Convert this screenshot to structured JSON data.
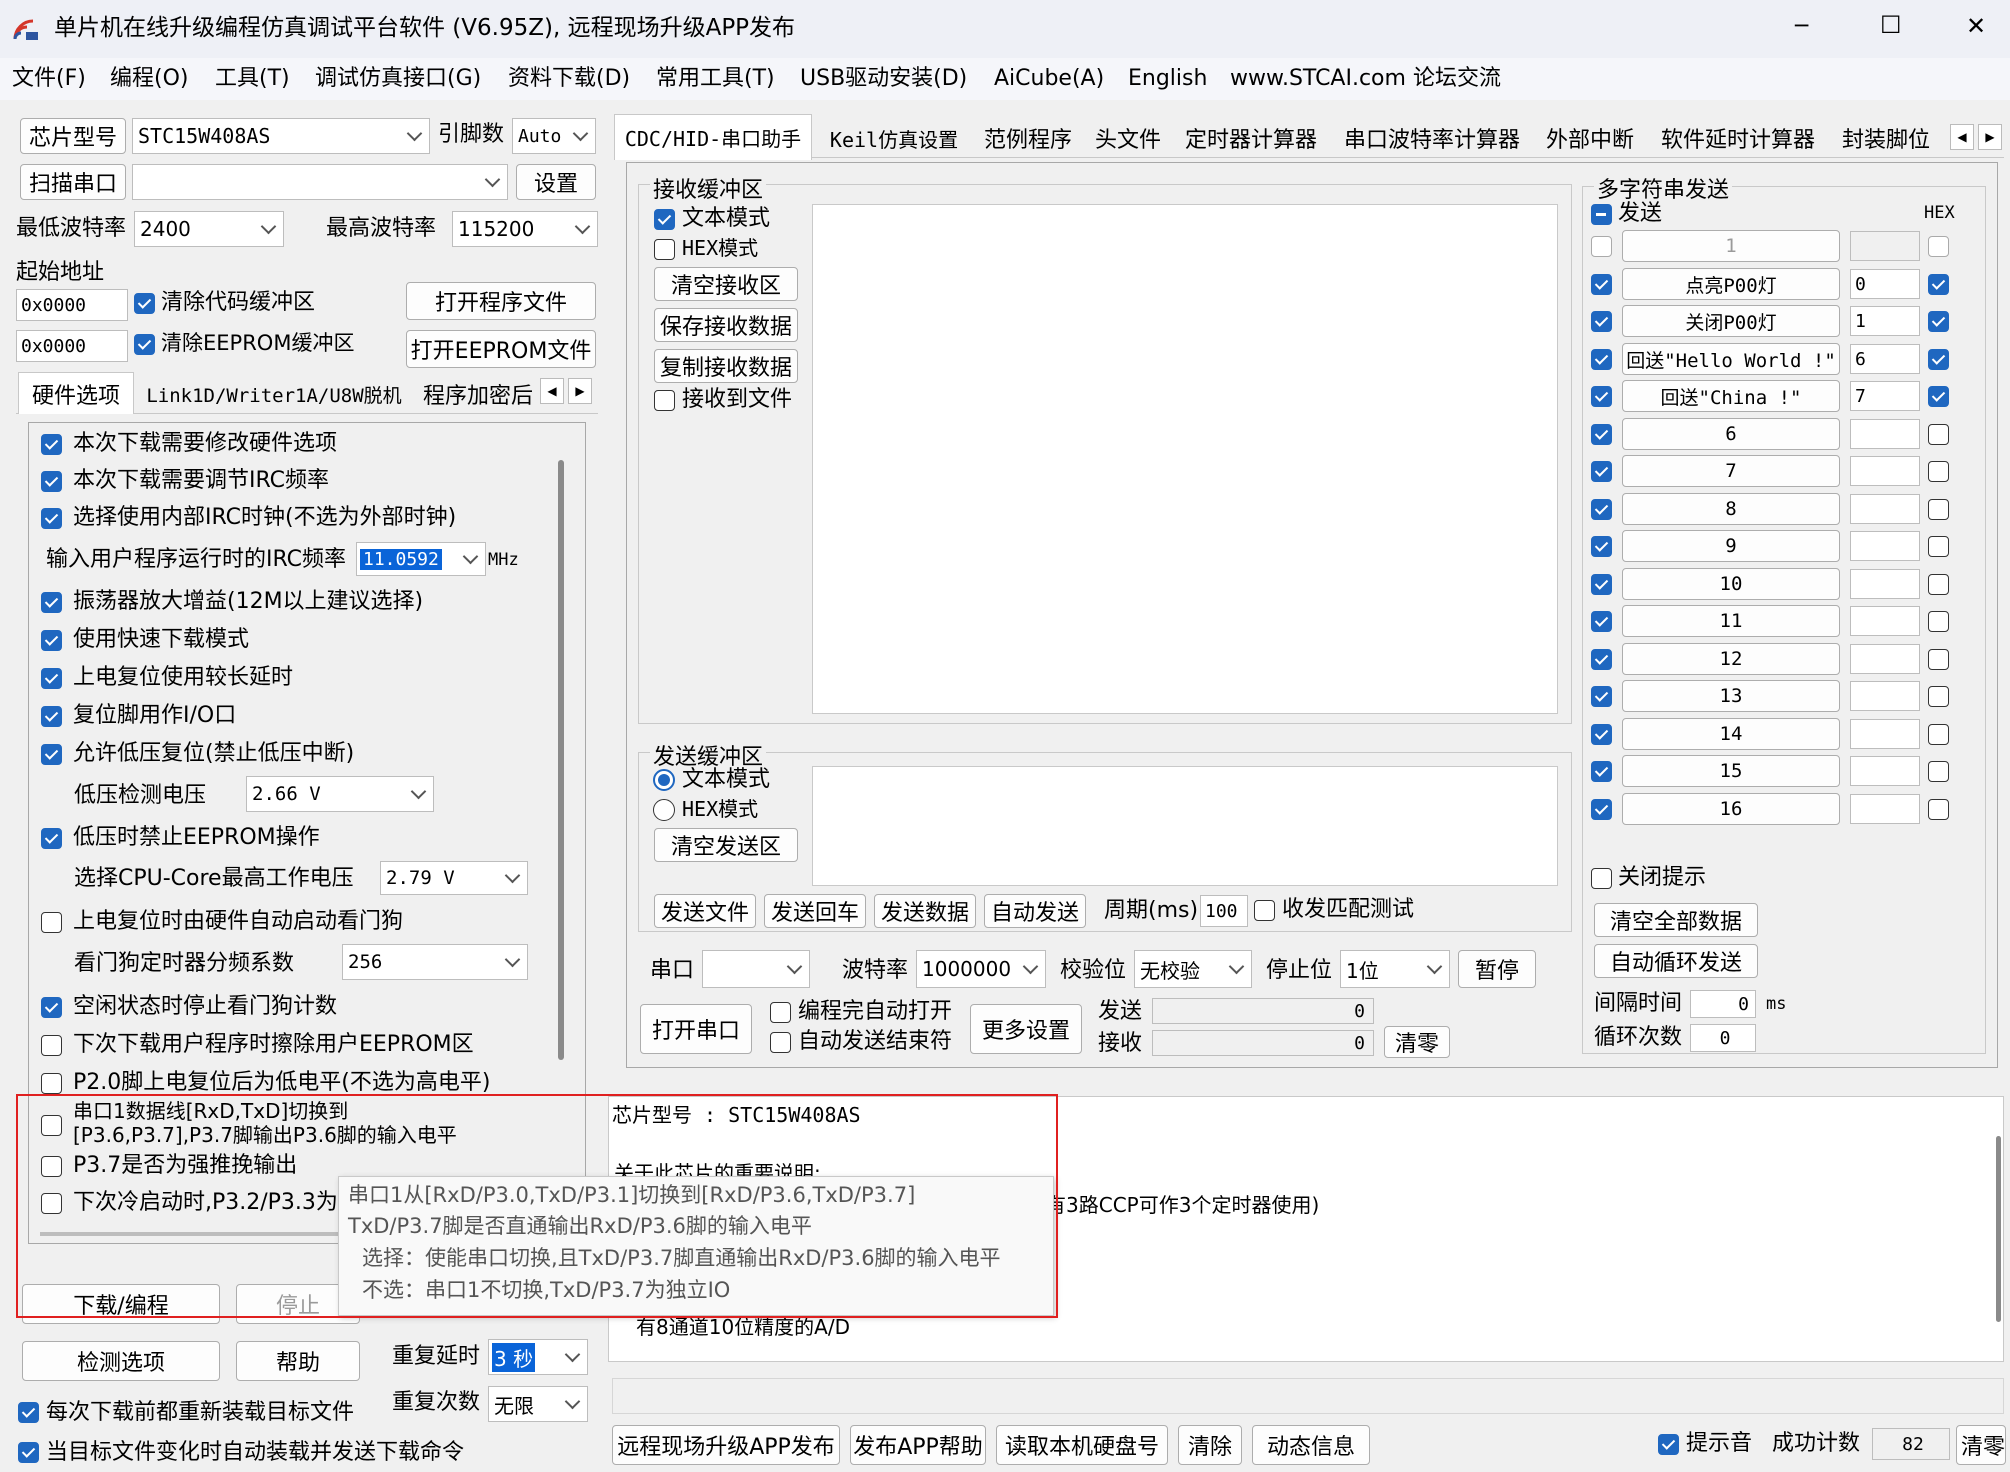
{
  "window": {
    "title": "单片机在线升级编程仿真调试平台软件 (V6.95Z), 远程现场升级APP发布",
    "controls": {
      "minimize": "─",
      "maximize": "☐",
      "close": "✕"
    }
  },
  "menu": [
    "文件(F)",
    "编程(O)",
    "工具(T)",
    "调试仿真接口(G)",
    "资料下载(D)",
    "常用工具(T)",
    "USB驱动安装(D)",
    "AiCube(A)",
    "English",
    "www.STCAI.com 论坛交流"
  ],
  "left": {
    "chip_label": "芯片型号",
    "chip_value": "STC15W408AS",
    "pins_label": "引脚数",
    "pins_value": "Auto",
    "scan_port": "扫描串口",
    "settings": "设置",
    "min_baud_label": "最低波特率",
    "min_baud_value": "2400",
    "max_baud_label": "最高波特率",
    "max_baud_value": "115200",
    "start_addr_label": "起始地址",
    "addr1": "0x0000",
    "clear_code": "清除代码缓冲区",
    "open_program": "打开程序文件",
    "addr2": "0x0000",
    "clear_eeprom": "清除EEPROM缓冲区",
    "open_eeprom": "打开EEPROM文件",
    "tabs": [
      "硬件选项",
      "Link1D/Writer1A/U8W脱机",
      "程序加密后"
    ],
    "options": {
      "o1": "本次下载需要修改硬件选项",
      "o2": "本次下载需要调节IRC频率",
      "o3": "选择使用内部IRC时钟(不选为外部时钟)",
      "irc_label": "输入用户程序运行时的IRC频率",
      "irc_value": "11.0592",
      "irc_unit": "MHz",
      "o4": "振荡器放大增益(12M以上建议选择)",
      "o5": "使用快速下载模式",
      "o6": "上电复位使用较长延时",
      "o7": "复位脚用作I/O口",
      "o8": "允许低压复位(禁止低压中断)",
      "lv_label": "低压检测电压",
      "lv_value": "2.66 V",
      "o9": "低压时禁止EEPROM操作",
      "cpu_label": "选择CPU-Core最高工作电压",
      "cpu_value": "2.79 V",
      "o10": "上电复位时由硬件自动启动看门狗",
      "wdt_label": "看门狗定时器分频系数",
      "wdt_value": "256",
      "o11": "空闲状态时停止看门狗计数",
      "o12": "下次下载用户程序时擦除用户EEPROM区",
      "o13": "P2.0脚上电复位后为低电平(不选为高电平)",
      "o14a": "串口1数据线[RxD,TxD]切换到",
      "o14b": "[P3.6,P3.7],P3.7脚输出P3.6脚的输入电平",
      "o15": "P3.7是否为强推挽输出",
      "o16": "下次冷启动时,P3.2/P3.3为"
    },
    "download": "下载/编程",
    "stop": "停止",
    "check_options": "检测选项",
    "help": "帮助",
    "repeat_delay_label": "重复延时",
    "repeat_delay_value": "3 秒",
    "repeat_count_label": "重复次数",
    "repeat_count_value": "无限",
    "reload_before": "每次下载前都重新装载目标文件",
    "auto_reload": "当目标文件变化时自动装载并发送下载命令"
  },
  "right_tabs": [
    "CDC/HID-串口助手",
    "Keil仿真设置",
    "范例程序",
    "头文件",
    "定时器计算器",
    "串口波特率计算器",
    "外部中断",
    "软件延时计算器",
    "封装脚位"
  ],
  "serial": {
    "recv_title": "接收缓冲区",
    "text_mode": "文本模式",
    "hex_mode": "HEX模式",
    "clear_recv": "清空接收区",
    "save_recv": "保存接收数据",
    "copy_recv": "复制接收数据",
    "recv_to_file": "接收到文件",
    "send_title": "发送缓冲区",
    "clear_send": "清空发送区",
    "send_file": "发送文件",
    "send_enter": "发送回车",
    "send_data": "发送数据",
    "auto_send": "自动发送",
    "period_label": "周期(ms)",
    "period_value": "100",
    "match_test": "收发匹配测试",
    "port_label": "串口",
    "baud_label": "波特率",
    "baud_value": "1000000",
    "parity_label": "校验位",
    "parity_value": "无校验",
    "stop_label": "停止位",
    "stop_value": "1位",
    "pause": "暂停",
    "open_port": "打开串口",
    "auto_open": "编程完自动打开",
    "auto_end": "自动发送结束符",
    "more_settings": "更多设置",
    "send_count_label": "发送",
    "send_count": "0",
    "recv_count_label": "接收",
    "recv_count": "0",
    "clear_count": "清零"
  },
  "multi": {
    "title": "多字符串发送",
    "send_header": "发送",
    "hex_header": "HEX",
    "rows": [
      {
        "label": "1",
        "value": "",
        "checked": false,
        "hex": false,
        "disabled": true
      },
      {
        "label": "点亮P00灯",
        "value": "0",
        "checked": true,
        "hex": true
      },
      {
        "label": "关闭P00灯",
        "value": "1",
        "checked": true,
        "hex": true
      },
      {
        "label": "回送\"Hello World !\"",
        "value": "6",
        "checked": true,
        "hex": true
      },
      {
        "label": "回送\"China !\"",
        "value": "7",
        "checked": true,
        "hex": true
      },
      {
        "label": "6",
        "value": "",
        "checked": true,
        "hex": false
      },
      {
        "label": "7",
        "value": "",
        "checked": true,
        "hex": false
      },
      {
        "label": "8",
        "value": "",
        "checked": true,
        "hex": false
      },
      {
        "label": "9",
        "value": "",
        "checked": true,
        "hex": false
      },
      {
        "label": "10",
        "value": "",
        "checked": true,
        "hex": false
      },
      {
        "label": "11",
        "value": "",
        "checked": true,
        "hex": false
      },
      {
        "label": "12",
        "value": "",
        "checked": true,
        "hex": false
      },
      {
        "label": "13",
        "value": "",
        "checked": true,
        "hex": false
      },
      {
        "label": "14",
        "value": "",
        "checked": true,
        "hex": false
      },
      {
        "label": "15",
        "value": "",
        "checked": true,
        "hex": false
      },
      {
        "label": "16",
        "value": "",
        "checked": true,
        "hex": false
      }
    ],
    "close_tips": "关闭提示",
    "clear_all": "清空全部数据",
    "auto_loop": "自动循环发送",
    "interval_label": "间隔时间",
    "interval_value": "0",
    "interval_unit": "ms",
    "loop_label": "循环次数",
    "loop_value": "0"
  },
  "info": {
    "line1": "芯片型号 : STC15W408AS",
    "line2": "关于此芯片的重要说明:",
    "line3": "有3路CCP可作3个定时器使用)",
    "line4": "有8通道10位精度的A/D"
  },
  "tooltip": {
    "l1": "串口1从[RxD/P3.0,TxD/P3.1]切换到[RxD/P3.6,TxD/P3.7]",
    "l2": "TxD/P3.7脚是否直通输出RxD/P3.6脚的输入电平",
    "l3": "选择：使能串口切换,且TxD/P3.7脚直通输出RxD/P3.6脚的输入电平",
    "l4": "不选：串口1不切换,TxD/P3.7为独立IO"
  },
  "bottom": {
    "remote_app": "远程现场升级APP发布",
    "app_help": "发布APP帮助",
    "read_disk": "读取本机硬盘号",
    "clear": "清除",
    "dynamic_info": "动态信息",
    "beep": "提示音",
    "success_label": "成功计数",
    "success_value": "82",
    "clear_zero": "清零"
  },
  "colors": {
    "accent": "#1f67c0",
    "highlight_border": "#e02020",
    "selection": "#0a64d8"
  }
}
